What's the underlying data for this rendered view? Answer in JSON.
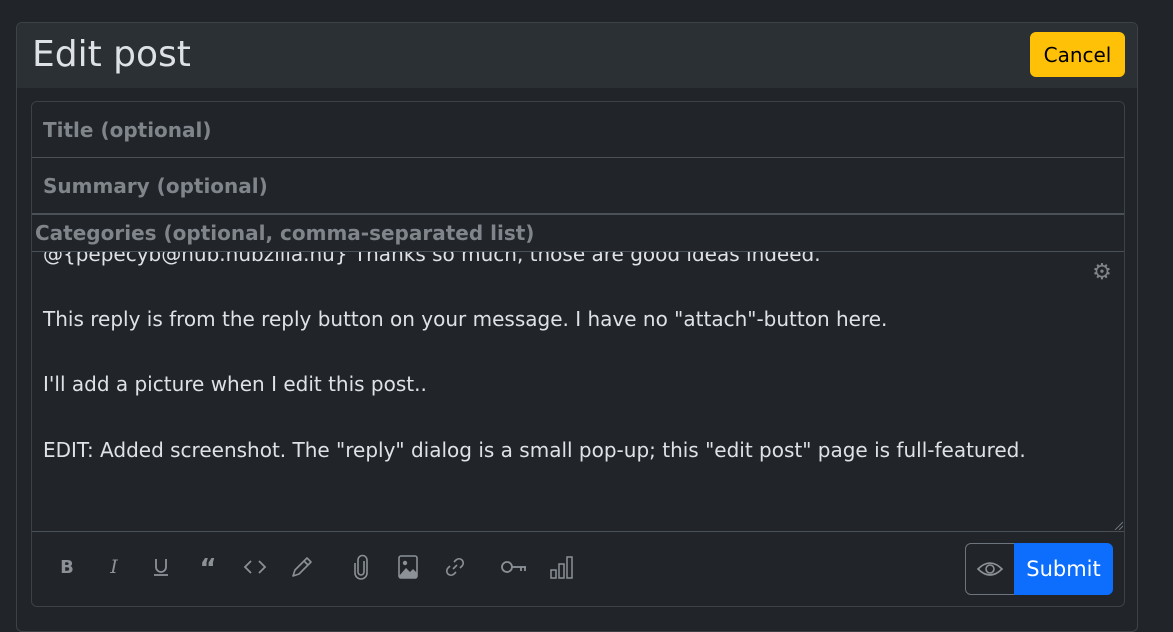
{
  "header": {
    "title": "Edit post",
    "cancel_label": "Cancel"
  },
  "form": {
    "title_placeholder": "Title (optional)",
    "summary_placeholder": "Summary (optional)",
    "categories_placeholder": "Categories (optional, comma-separated list)",
    "body_lines": [
      "@{pepecyb@hub.hubzilla.hu} Thanks so much, those are good ideas indeed.",
      "This reply is from the reply button on your message. I have no \"attach\"-button here.",
      "I'll add a picture when I edit this post..",
      "EDIT: Added screenshot. The \"reply\" dialog is a small pop-up; this \"edit post\" page is full-featured."
    ]
  },
  "toolbar": {
    "tools": [
      "bold-icon",
      "italic-icon",
      "underline-icon",
      "quote-icon",
      "code-icon",
      "pencil-icon",
      "paperclip-icon",
      "image-icon",
      "link-icon",
      "key-icon",
      "bar-chart-icon"
    ],
    "preview_icon": "eye-icon",
    "submit_label": "Submit"
  },
  "colors": {
    "background": "#212429",
    "header": "#2b3035",
    "cancel": "#ffc107",
    "submit": "#0d6efd"
  }
}
